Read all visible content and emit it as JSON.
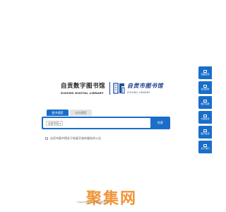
{
  "logo": {
    "cn": "自贡数字图书馆",
    "en": "ZIGONG DIGITAL LIBRARY",
    "sub_cn": "自贡市图书馆",
    "sub_en": "ZIGONG LIBRARY",
    "emblem": "library-emblem-icon",
    "color": "#1a3f8a"
  },
  "tabs": [
    {
      "label": "图书搜索",
      "active": true
    },
    {
      "label": "站内搜索",
      "active": false
    }
  ],
  "search": {
    "scope_value": "全部字段",
    "query_value": "",
    "button_label": "检索",
    "accent": "#1a6ec9"
  },
  "notice": {
    "text": "自贡市图书馆关于恢复开放的服务的公告"
  },
  "sidebar": {
    "items": [
      {
        "label": "馆藏检索",
        "icon": "search-icon"
      },
      {
        "label": "在线服务",
        "icon": "phone-icon"
      },
      {
        "label": "数字书屋",
        "icon": "book-icon"
      },
      {
        "label": "书籍检索",
        "icon": "catalog-icon"
      },
      {
        "label": "数字资源",
        "icon": "grid-icon"
      },
      {
        "label": "关于我们",
        "icon": "info-icon"
      }
    ]
  },
  "watermark": "聚集网",
  "copyright": "Copyright © 自贡市图书馆"
}
